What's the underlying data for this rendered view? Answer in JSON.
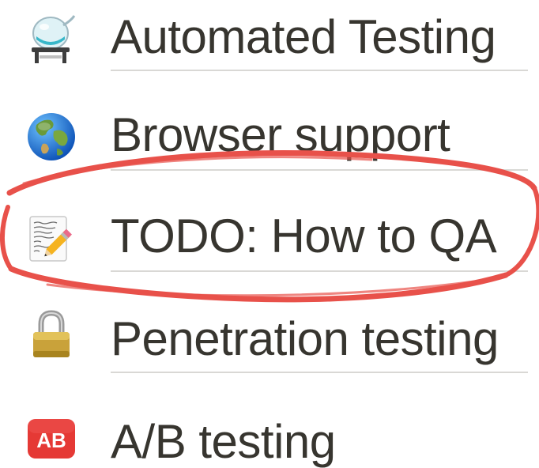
{
  "pages": [
    {
      "label": "Automated Testing",
      "icon": "test-tube-lab-icon"
    },
    {
      "label": "Browser support",
      "icon": "globe-icon"
    },
    {
      "label": "TODO: How to QA",
      "icon": "memo-pencil-icon"
    },
    {
      "label": "Penetration testing",
      "icon": "padlock-icon"
    },
    {
      "label": "A/B testing",
      "icon": "ab-button-icon"
    }
  ],
  "ab_icon_text": "AB",
  "annotation": {
    "type": "hand-drawn-ellipse",
    "color": "#e8514a",
    "target": "TODO: How to QA"
  },
  "colors": {
    "text": "#37352f",
    "underline": "#d9d8d5",
    "annotation": "#e8514a"
  }
}
